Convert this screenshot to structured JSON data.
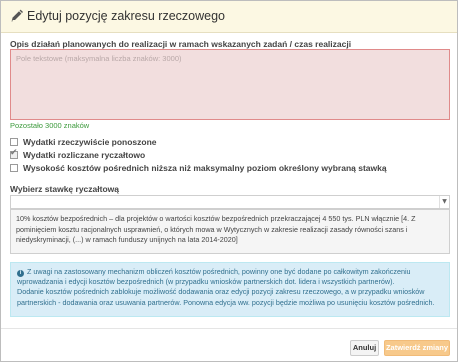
{
  "modal": {
    "title": "Edytuj pozycję zakresu rzeczowego"
  },
  "description": {
    "label": "Opis działań planowanych do realizacji w ramach wskazanych zadań / czas realizacji",
    "placeholder": "Pole tekstowe (maksymalna liczba znaków: 3000)",
    "value": "",
    "remaining": "Pozostało 3000 znaków"
  },
  "checkboxes": [
    {
      "label": "Wydatki rzeczywiście ponoszone",
      "checked": false
    },
    {
      "label": "Wydatki rozliczane ryczałtowo",
      "checked": true
    },
    {
      "label": "Wysokość kosztów pośrednich niższa niż maksymalny poziom określony wybraną stawką",
      "checked": false
    }
  ],
  "rate": {
    "label": "Wybierz stawkę ryczałtową",
    "selected": "",
    "option_text": "10% kosztów bezpośrednich – dla projektów o wartości kosztów bezpośrednich przekraczającej 4 550 tys. PLN włącznie [4. Z pominięciem kosztu racjonalnych usprawnień, o których mowa w Wytycznych w zakresie realizacji zasady równości szans i niedyskryminacji, (...) w ramach funduszy unijnych na lata 2014-2020]"
  },
  "info": {
    "line1": "Z uwagi na zastosowany mechanizm obliczeń kosztów pośrednich, powinny one być dodane po całkowitym zakończeniu wprowadzania i edycji kosztów bezpośrednich (w przypadku wniosków partnerskich dot. lidera i wszystkich partnerów).",
    "line2": "Dodanie kosztów pośrednich zablokuje możliwość dodawania oraz edycji pozycji zakresu rzeczowego, a w przypadku wniosków partnerskich - dodawania oraz usuwania partnerów. Ponowna edycja ww. pozycji będzie możliwa po usunięciu kosztów pośrednich."
  },
  "footer": {
    "cancel_label": "Anuluj",
    "confirm_label": "Zatwierdź zmiany"
  },
  "icons": {
    "header": "pencil-icon",
    "info": "info-circle-icon",
    "select": "caret-down-icon"
  },
  "colors": {
    "header_bg": "#fcf8e3",
    "textarea_error_bg": "#f2dede",
    "textarea_error_border": "#e08a8a",
    "counter_green": "#3c9a3c",
    "info_bg": "#d9edf7",
    "info_text": "#31708f",
    "confirm_btn": "#f7c98b"
  }
}
